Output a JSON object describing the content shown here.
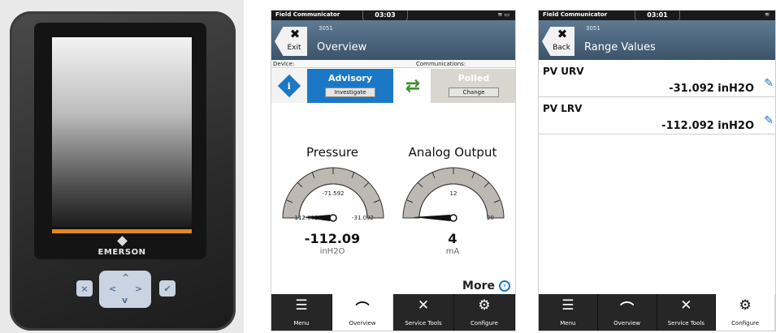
{
  "device": {
    "brand": "EMERSON",
    "buttons": {
      "cancel_glyph": "×",
      "ok_glyph": "✔"
    },
    "pad_arrows": {
      "up": "^",
      "down": "v",
      "left": "<",
      "right": ">"
    }
  },
  "status_bar": {
    "app_name": "Field Communicator",
    "time_overview": "03:03",
    "time_range": "03:01"
  },
  "overview": {
    "nav": {
      "exit_label": "Exit",
      "device_tag": "3051",
      "title": "Overview"
    },
    "device_label": "Device:",
    "communications_label": "Communications:",
    "device_status": {
      "title": "Advisory",
      "button": "Investigate"
    },
    "comm_status": {
      "title": "Polled",
      "button": "Change"
    },
    "gauges": [
      {
        "title": "Pressure",
        "value": "-112.09",
        "unit": "inH2O",
        "scale_min": "-112.092",
        "scale_mid": "-71.592",
        "scale_max": "-31.092",
        "fill_fraction": 0.0
      },
      {
        "title": "Analog Output",
        "value": "4",
        "unit": "mA",
        "scale_min": "4",
        "scale_mid": "12",
        "scale_max": "20",
        "fill_fraction": 0.0
      }
    ],
    "more_label": "More"
  },
  "range_values": {
    "nav": {
      "back_label": "Back",
      "device_tag": "3051",
      "title": "Range Values"
    },
    "rows": [
      {
        "label": "PV URV",
        "value": "-31.092 inH2O"
      },
      {
        "label": "PV LRV",
        "value": "-112.092 inH2O"
      }
    ]
  },
  "tabs": [
    {
      "label": "Menu",
      "icon": "menu-icon"
    },
    {
      "label": "Overview",
      "icon": "gauge-icon"
    },
    {
      "label": "Service Tools",
      "icon": "tools-icon"
    },
    {
      "label": "Configure",
      "icon": "gears-icon"
    }
  ],
  "colors": {
    "titlebar": "#4a6479",
    "advisory_blue": "#1b78c6",
    "polled_gray": "#d9d6cf",
    "comm_green": "#3e8e2f",
    "tabbar": "#262626"
  }
}
